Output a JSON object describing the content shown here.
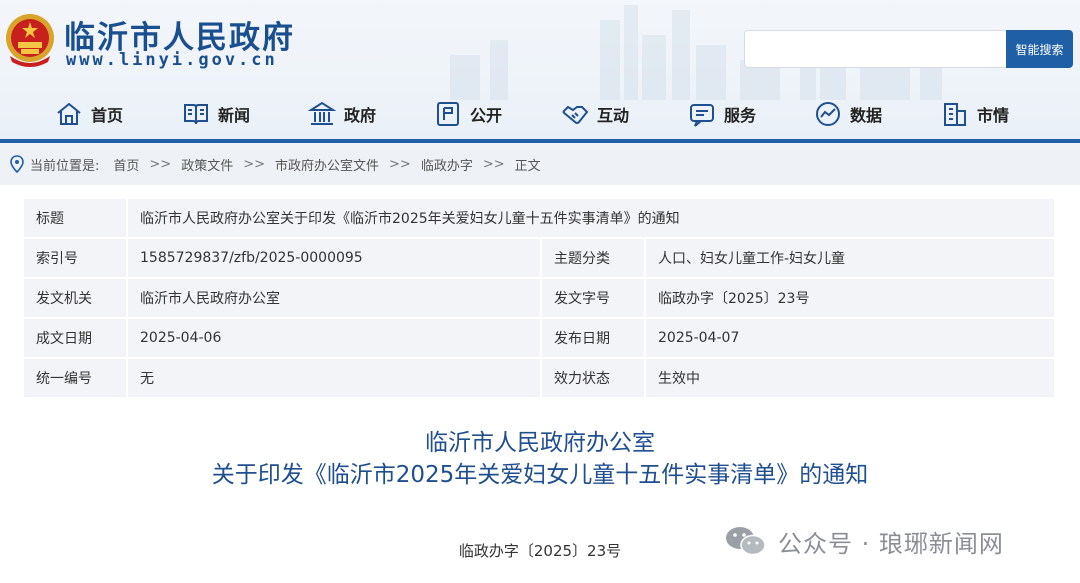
{
  "header": {
    "site_title": "临沂市人民政府",
    "site_domain": "www.linyi.gov.cn",
    "search": {
      "placeholder": "",
      "button_label": "智能搜索"
    },
    "nav": [
      {
        "label": "首页",
        "icon": "home-icon"
      },
      {
        "label": "新闻",
        "icon": "news-icon"
      },
      {
        "label": "政府",
        "icon": "government-building-icon"
      },
      {
        "label": "公开",
        "icon": "disclosure-icon"
      },
      {
        "label": "互动",
        "icon": "handshake-icon"
      },
      {
        "label": "服务",
        "icon": "service-icon"
      },
      {
        "label": "数据",
        "icon": "data-icon"
      },
      {
        "label": "市情",
        "icon": "city-icon"
      }
    ]
  },
  "breadcrumb": {
    "prefix": "当前位置是:",
    "items": [
      "首页",
      "政策文件",
      "市政府办公室文件",
      "临政办字",
      "正文"
    ],
    "separator": ">>"
  },
  "info": {
    "title_label": "标题",
    "title_value": "临沂市人民政府办公室关于印发《临沂市2025年关爱妇女儿童十五件实事清单》的通知",
    "rows": [
      {
        "k1": "索引号",
        "v1": "1585729837/zfb/2025-0000095",
        "k2": "主题分类",
        "v2": "人口、妇女儿童工作-妇女儿童"
      },
      {
        "k1": "发文机关",
        "v1": "临沂市人民政府办公室",
        "k2": "发文字号",
        "v2": "临政办字〔2025〕23号"
      },
      {
        "k1": "成文日期",
        "v1": "2025-04-06",
        "k2": "发布日期",
        "v2": "2025-04-07"
      },
      {
        "k1": "统一编号",
        "v1": "无",
        "k2": "效力状态",
        "v2": "生效中"
      }
    ]
  },
  "document": {
    "title_line1": "临沂市人民政府办公室",
    "title_line2": "关于印发《临沂市2025年关爱妇女儿童十五件实事清单》的通知",
    "number": "临政办字〔2025〕23号"
  },
  "watermark": {
    "text": "公众号 · 琅琊新闻网",
    "icon": "wechat-icon"
  },
  "colors": {
    "brand_blue": "#1f5fa6",
    "title_blue": "#1f4f8f",
    "table_bg": "#f2f4f7"
  }
}
